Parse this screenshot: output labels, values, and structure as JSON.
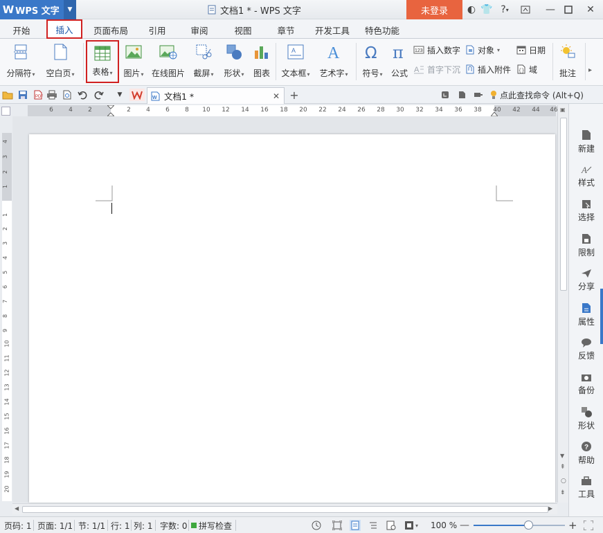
{
  "app": {
    "brand": "WPS 文字",
    "doc_title": "文档1 * - WPS 文字",
    "login": "未登录"
  },
  "menu": [
    "开始",
    "插入",
    "页面布局",
    "引用",
    "审阅",
    "视图",
    "章节",
    "开发工具",
    "特色功能"
  ],
  "ribbon": {
    "big": [
      "分隔符",
      "空白页",
      "表格",
      "图片",
      "在线图片",
      "截屏",
      "形状",
      "图表",
      "文本框",
      "艺术字",
      "符号",
      "公式",
      "批注"
    ],
    "small": [
      "插入数字",
      "对象",
      "日期",
      "首字下沉",
      "插入附件",
      "域"
    ]
  },
  "tab": {
    "name": "文档1 *"
  },
  "command_search": "点此查找命令 (Alt+Q)",
  "hruler_ticks": [
    "6",
    "4",
    "2",
    "2",
    "4",
    "6",
    "8",
    "10",
    "12",
    "14",
    "16",
    "18",
    "20",
    "22",
    "24",
    "26",
    "28",
    "30",
    "32",
    "34",
    "36",
    "38",
    "40",
    "42",
    "44",
    "46"
  ],
  "vruler_ticks": [
    "4",
    "3",
    "2",
    "1",
    "1",
    "2",
    "3",
    "4",
    "5",
    "6",
    "7",
    "8",
    "9",
    "10",
    "11",
    "12",
    "13",
    "14",
    "15",
    "16",
    "17",
    "18",
    "19",
    "20"
  ],
  "sidebar": [
    "新建",
    "样式",
    "选择",
    "限制",
    "分享",
    "属性",
    "反馈",
    "备份",
    "形状",
    "帮助",
    "工具"
  ],
  "status": {
    "page_no": "页码: 1",
    "pages": "页面: 1/1",
    "section": "节: 1/1",
    "row": "行: 1",
    "col": "列: 1",
    "words": "字数: 0",
    "spell": "拼写检查",
    "zoom": "100 %",
    "zoom_fraction": 0.6
  },
  "colors": {
    "brand": "#3a78c8",
    "login": "#e8643f",
    "highlight": "#d02020"
  }
}
